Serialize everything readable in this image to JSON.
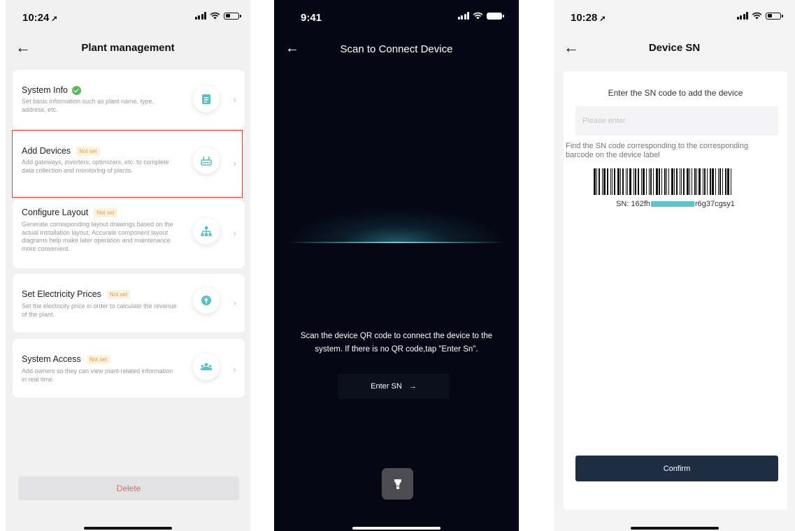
{
  "screen1": {
    "status_time": "10:24",
    "title": "Plant management",
    "cards": [
      {
        "title": "System Info",
        "badge": "",
        "desc": "Set basic information such as plant name, type, address, etc.",
        "icon": "document-icon",
        "status": "completed"
      },
      {
        "title": "Add Devices",
        "badge": "Not set",
        "desc": "Add gateways, inverters, optimizers, etc. to complete data collection and monitoring of plants.",
        "icon": "device-icon"
      },
      {
        "title": "Configure Layout",
        "badge": "Not set",
        "desc": "Generate corresponding layout drawings based on the actual installation layout. Accurate component layout diagrams help make later operation and maintenance more convenient.",
        "icon": "layout-icon"
      },
      {
        "title": "Set Electricity Prices",
        "badge": "Not set",
        "desc": "Set the electricity price in order to calculate the revenue of the plant.",
        "icon": "price-icon"
      },
      {
        "title": "System Access",
        "badge": "Not set",
        "desc": "Add owners so they can view plant-related information in real time.",
        "icon": "users-icon"
      }
    ],
    "delete_label": "Delete",
    "accent_color": "#5bbfc6",
    "highlight_color": "#d84a3c"
  },
  "screen2": {
    "status_time": "9:41",
    "title": "Scan to Connect Device",
    "instruction": "Scan the device QR code to connect the device to the system. If there is no QR code,tap \"Enter Sn\".",
    "enter_sn_label": "Enter SN",
    "enter_sn_arrow": "→",
    "torch_icon": "flashlight-icon"
  },
  "screen3": {
    "status_time": "10:28",
    "title": "Device SN",
    "heading": "Enter the SN code to add the device",
    "input_placeholder": "Please enter",
    "hint": "Find the SN code corresponding to the corresponding barcode on the device label",
    "sn_prefix": "SN: 162fh",
    "sn_suffix": "r6g37cgsy1",
    "confirm_label": "Confirm",
    "confirm_color": "#1f2d42"
  }
}
